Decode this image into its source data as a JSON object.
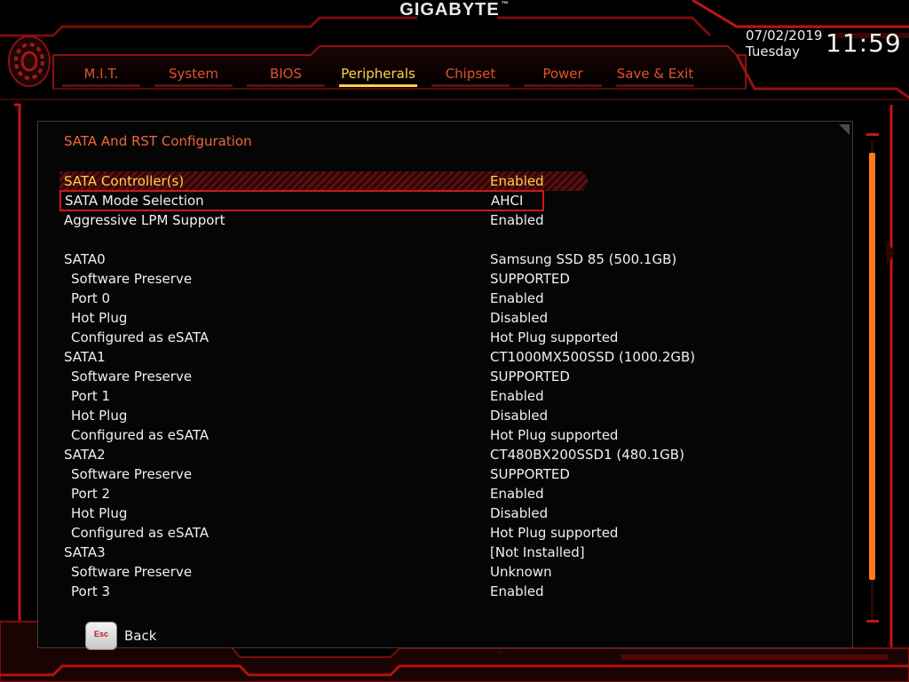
{
  "header": {
    "brand": "GIGABYTE",
    "trademark": "™",
    "date": "07/02/2019",
    "day": "Tuesday",
    "time": "11:59"
  },
  "tabs": [
    {
      "label": "M.I.T.",
      "active": false
    },
    {
      "label": "System",
      "active": false
    },
    {
      "label": "BIOS",
      "active": false
    },
    {
      "label": "Peripherals",
      "active": true
    },
    {
      "label": "Chipset",
      "active": false
    },
    {
      "label": "Power",
      "active": false
    },
    {
      "label": "Save & Exit",
      "active": false
    }
  ],
  "section_title": "SATA And RST Configuration",
  "rows": [
    {
      "label": "SATA Controller(s)",
      "value": "Enabled",
      "highlight": true
    },
    {
      "label": "SATA Mode Selection",
      "value": "AHCI",
      "boxed": true
    },
    {
      "label": "Aggressive LPM Support",
      "value": "Enabled"
    },
    {
      "label": "SATA0",
      "value": "Samsung SSD 85 (500.1GB)"
    },
    {
      "label": "Software Preserve",
      "value": "SUPPORTED",
      "indent": true
    },
    {
      "label": "Port 0",
      "value": "Enabled",
      "indent": true
    },
    {
      "label": "Hot Plug",
      "value": "Disabled",
      "indent": true
    },
    {
      "label": "Configured as eSATA",
      "value": "Hot Plug supported",
      "indent": true
    },
    {
      "label": "SATA1",
      "value": "CT1000MX500SSD (1000.2GB)"
    },
    {
      "label": "Software Preserve",
      "value": "SUPPORTED",
      "indent": true
    },
    {
      "label": "Port 1",
      "value": "Enabled",
      "indent": true
    },
    {
      "label": "Hot Plug",
      "value": "Disabled",
      "indent": true
    },
    {
      "label": "Configured as eSATA",
      "value": "Hot Plug supported",
      "indent": true
    },
    {
      "label": "SATA2",
      "value": "CT480BX200SSD1 (480.1GB)"
    },
    {
      "label": "Software Preserve",
      "value": "SUPPORTED",
      "indent": true
    },
    {
      "label": "Port 2",
      "value": "Enabled",
      "indent": true
    },
    {
      "label": "Hot Plug",
      "value": "Disabled",
      "indent": true
    },
    {
      "label": "Configured as eSATA",
      "value": "Hot Plug supported",
      "indent": true
    },
    {
      "label": "SATA3",
      "value": "[Not Installed]"
    },
    {
      "label": "Software Preserve",
      "value": "Unknown",
      "indent": true
    },
    {
      "label": "Port 3",
      "value": "Enabled",
      "indent": true
    }
  ],
  "footer": {
    "esc_key": "Esc",
    "back_label": "Back"
  },
  "scrollbar": {
    "position_fraction": 0.0,
    "visible_fraction": 0.89
  },
  "colors": {
    "accent_red": "#c01818",
    "active_yellow": "#ffd24a",
    "tab_orange": "#e4502a",
    "scroll_orange": "#ff7a1c"
  }
}
